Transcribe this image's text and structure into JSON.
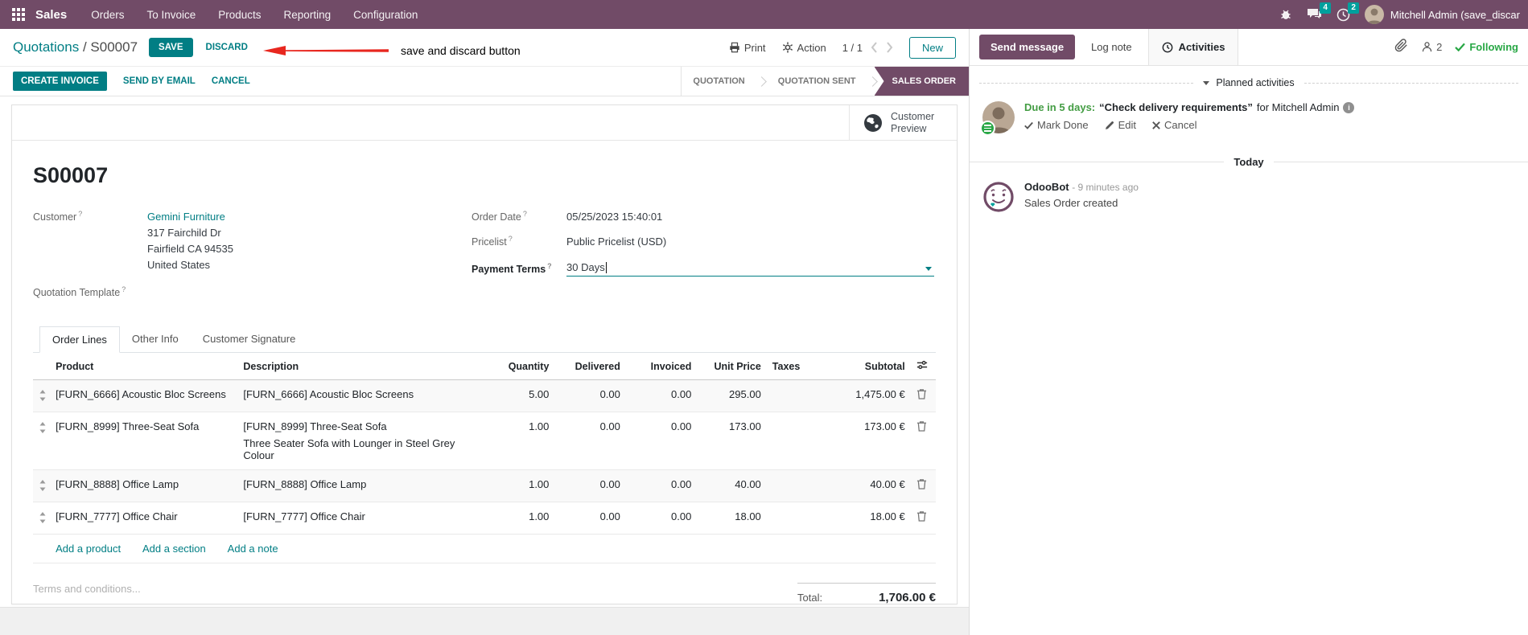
{
  "colors": {
    "brand": "#714B67",
    "accent_teal": "#017e84",
    "badge_teal": "#00A09D",
    "modified_blue": "#17a2b8",
    "success_green": "#28a745",
    "arrow_red": "#e8271f"
  },
  "topbar": {
    "app_name": "Sales",
    "menus": [
      {
        "label": "Orders"
      },
      {
        "label": "To Invoice"
      },
      {
        "label": "Products"
      },
      {
        "label": "Reporting"
      },
      {
        "label": "Configuration"
      }
    ],
    "messages_badge": "4",
    "activities_badge": "2",
    "user_name": "Mitchell Admin (save_discar"
  },
  "control_panel": {
    "breadcrumb_parent": "Quotations",
    "breadcrumb_sep": "/",
    "breadcrumb_current": "S00007",
    "save_label": "SAVE",
    "discard_label": "DISCARD",
    "annotation_text": "save and discard button",
    "print_label": "Print",
    "action_label": "Action",
    "pager_value": "1 / 1",
    "new_label": "New"
  },
  "status_row": {
    "create_invoice_label": "CREATE INVOICE",
    "send_by_email_label": "SEND BY EMAIL",
    "cancel_label": "CANCEL",
    "stages": [
      {
        "label": "QUOTATION",
        "active": false
      },
      {
        "label": "QUOTATION SENT",
        "active": false
      },
      {
        "label": "SALES ORDER",
        "active": true
      }
    ]
  },
  "form": {
    "customer_preview_label": "Customer Preview",
    "title": "S00007",
    "help_mark": "?",
    "customer_label": "Customer",
    "customer_name": "Gemini Furniture",
    "customer_address": [
      "317 Fairchild Dr",
      "Fairfield CA 94535",
      "United States"
    ],
    "quotation_template_label": "Quotation Template",
    "order_date_label": "Order Date",
    "order_date_value": "05/25/2023 15:40:01",
    "pricelist_label": "Pricelist",
    "pricelist_value": "Public Pricelist (USD)",
    "payment_terms_label": "Payment Terms",
    "payment_terms_value": "30 Days",
    "tabs": [
      {
        "label": "Order Lines",
        "active": true
      },
      {
        "label": "Other Info",
        "active": false
      },
      {
        "label": "Customer Signature",
        "active": false
      }
    ],
    "table": {
      "headers": [
        "Product",
        "Description",
        "Quantity",
        "Delivered",
        "Invoiced",
        "Unit Price",
        "Taxes",
        "Subtotal"
      ],
      "rows": [
        {
          "product": "[FURN_6666] Acoustic Bloc Screens",
          "description": "[FURN_6666] Acoustic Bloc Screens",
          "description2": "",
          "quantity": "5.00",
          "delivered": "0.00",
          "invoiced": "0.00",
          "unit_price": "295.00",
          "taxes": "",
          "subtotal": "1,475.00 €",
          "modified": false
        },
        {
          "product": "[FURN_8999] Three-Seat Sofa",
          "description": "[FURN_8999] Three-Seat Sofa",
          "description2": "Three Seater Sofa with Lounger in Steel Grey Colour",
          "quantity": "1.00",
          "delivered": "0.00",
          "invoiced": "0.00",
          "unit_price": "173.00",
          "taxes": "",
          "subtotal": "173.00 €",
          "modified": true
        },
        {
          "product": "[FURN_8888] Office Lamp",
          "description": "[FURN_8888] Office Lamp",
          "description2": "",
          "quantity": "1.00",
          "delivered": "0.00",
          "invoiced": "0.00",
          "unit_price": "40.00",
          "taxes": "",
          "subtotal": "40.00 €",
          "modified": false
        },
        {
          "product": "[FURN_7777] Office Chair",
          "description": "[FURN_7777] Office Chair",
          "description2": "",
          "quantity": "1.00",
          "delivered": "0.00",
          "invoiced": "0.00",
          "unit_price": "18.00",
          "taxes": "",
          "subtotal": "18.00 €",
          "modified": false
        }
      ],
      "footer_links": [
        {
          "label": "Add a product"
        },
        {
          "label": "Add a section"
        },
        {
          "label": "Add a note"
        }
      ]
    },
    "terms_placeholder": "Terms and conditions...",
    "total_label": "Total:",
    "total_value": "1,706.00 €"
  },
  "chatter": {
    "send_message_label": "Send message",
    "log_note_label": "Log note",
    "activities_label": "Activities",
    "followers_count": "2",
    "following_label": "Following",
    "planned_activities_title": "Planned activities",
    "activity": {
      "due": "Due in 5 days:",
      "summary": "“Check delivery requirements”",
      "for_text": "for Mitchell Admin",
      "mark_done_label": "Mark Done",
      "edit_label": "Edit",
      "cancel_label": "Cancel"
    },
    "today_label": "Today",
    "message": {
      "author": "OdooBot",
      "time": "- 9 minutes ago",
      "body": "Sales Order created"
    }
  }
}
